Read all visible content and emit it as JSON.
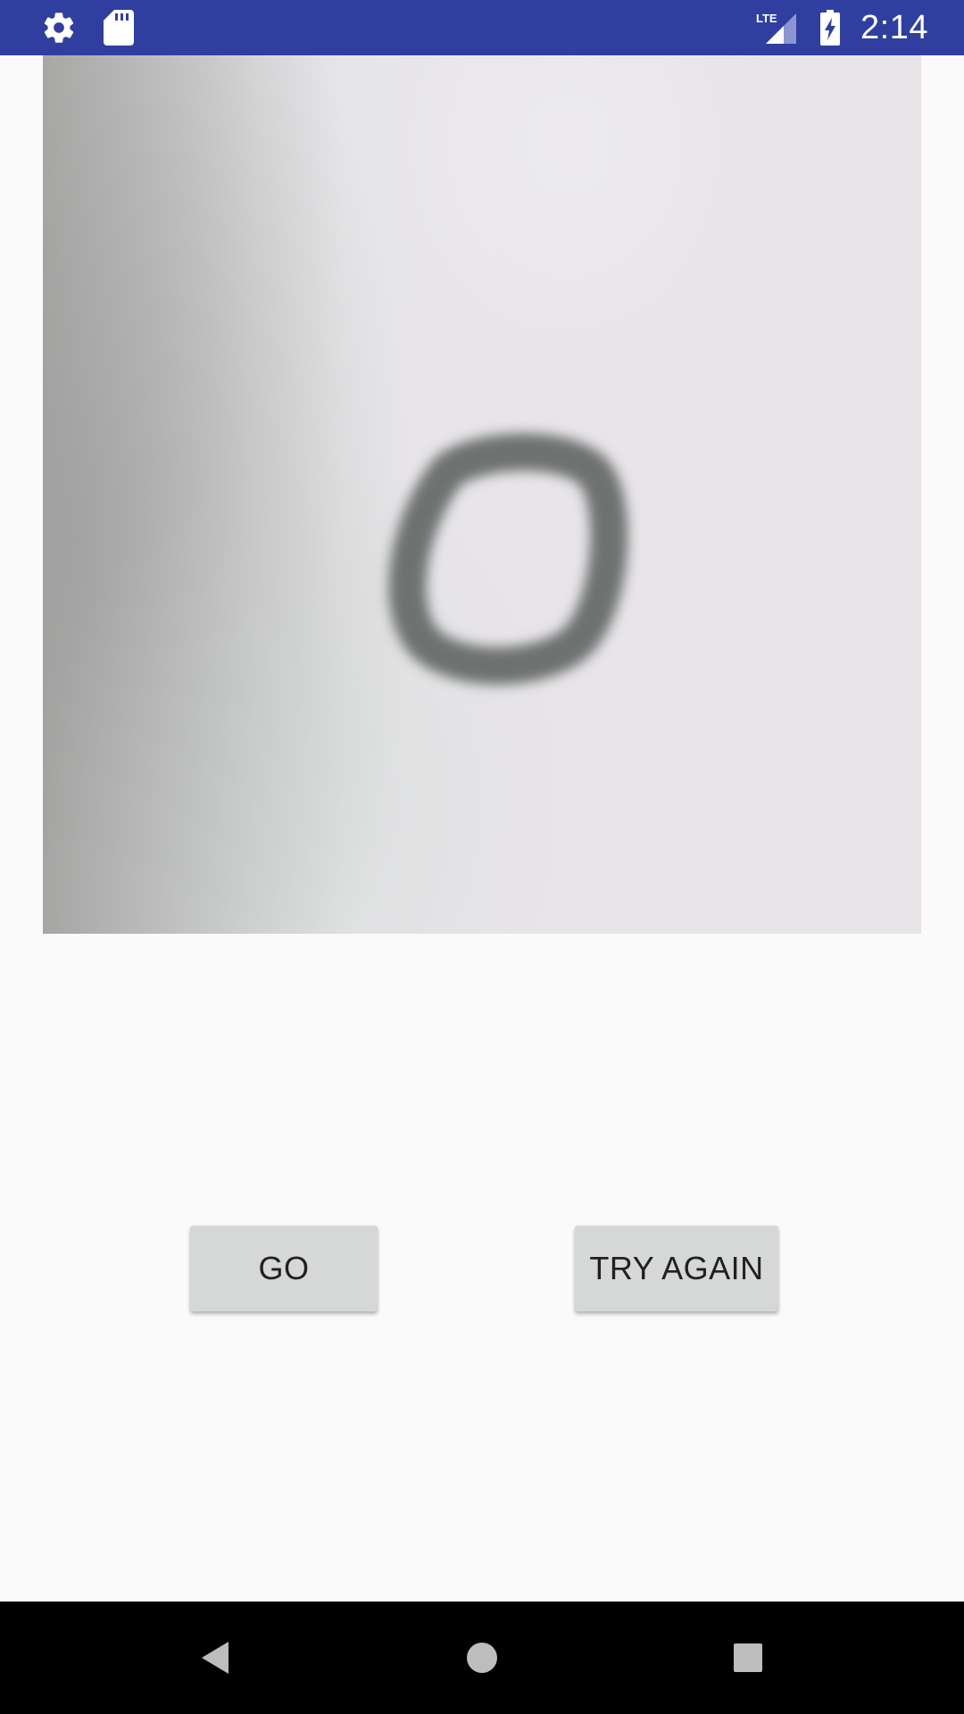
{
  "status_bar": {
    "time": "2:14",
    "network_label": "LTE",
    "background_color": "#303f9f",
    "left_icons": [
      "settings-icon",
      "sd-card-icon"
    ],
    "right_icons": [
      "lte-signal-icon",
      "battery-charging-icon"
    ]
  },
  "capture": {
    "description_icon": "captured-digit-image"
  },
  "buttons": {
    "go_label": "GO",
    "try_again_label": "TRY AGAIN"
  },
  "nav_bar": {
    "icons": [
      "back-icon",
      "home-icon",
      "recents-icon"
    ]
  }
}
